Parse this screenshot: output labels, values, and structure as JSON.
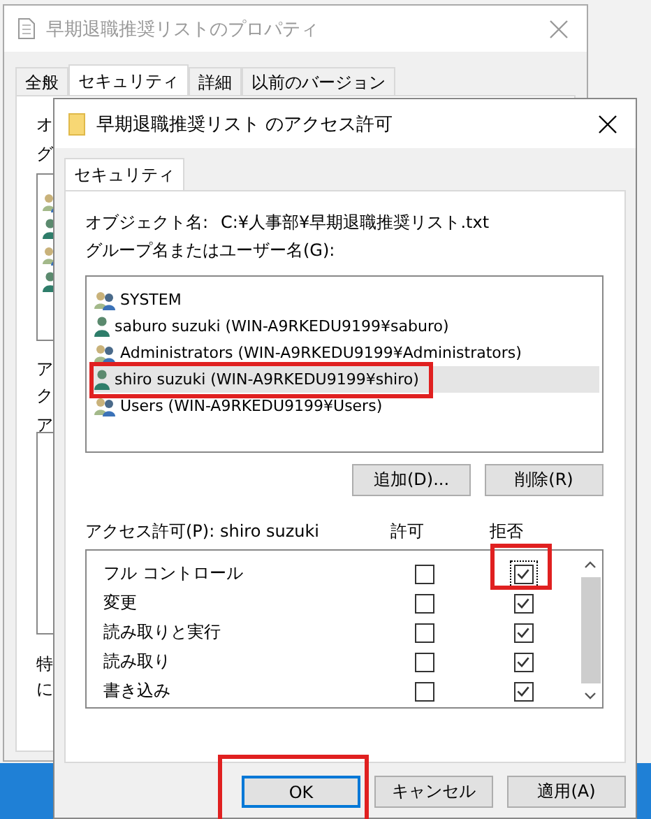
{
  "background_window": {
    "title": "早期退職推奨リストのプロパティ",
    "tabs": [
      {
        "label": "全般",
        "selected": false
      },
      {
        "label": "セキュリティ",
        "selected": true
      },
      {
        "label": "詳細",
        "selected": false
      },
      {
        "label": "以前のバージョン",
        "selected": false
      }
    ],
    "text_fragments": [
      "オ",
      "グ",
      "ア",
      "ク",
      "ア",
      "特",
      "に"
    ]
  },
  "dialog": {
    "title": "早期退職推奨リスト のアクセス許可",
    "tabs": [
      {
        "label": "セキュリティ",
        "selected": true
      }
    ],
    "object_label": "オブジェクト名:",
    "object_value": "C:¥人事部¥早期退職推奨リスト.txt",
    "group_label": "グループ名またはユーザー名(G):",
    "principals": [
      {
        "kind": "group",
        "name": "SYSTEM",
        "selected": false,
        "highlighted": false
      },
      {
        "kind": "user",
        "name": "saburo suzuki (WIN-A9RKEDU9199¥saburo)",
        "selected": false,
        "highlighted": false
      },
      {
        "kind": "group",
        "name": "Administrators (WIN-A9RKEDU9199¥Administrators)",
        "selected": false,
        "highlighted": false
      },
      {
        "kind": "user",
        "name": "shiro suzuki (WIN-A9RKEDU9199¥shiro)",
        "selected": true,
        "highlighted": true
      },
      {
        "kind": "group",
        "name": "Users (WIN-A9RKEDU9199¥Users)",
        "selected": false,
        "highlighted": false
      }
    ],
    "list_buttons": [
      "追加(D)...",
      "削除(R)"
    ],
    "permissions_label": "アクセス許可(P): shiro suzuki",
    "allow_header": "許可",
    "deny_header": "拒否",
    "permissions": [
      {
        "name": "フル コントロール",
        "allow": false,
        "deny": true,
        "focused": true,
        "deny_highlighted": true
      },
      {
        "name": "変更",
        "allow": false,
        "deny": true,
        "focused": false,
        "deny_highlighted": false
      },
      {
        "name": "読み取りと実行",
        "allow": false,
        "deny": true,
        "focused": false,
        "deny_highlighted": false
      },
      {
        "name": "読み取り",
        "allow": false,
        "deny": true,
        "focused": false,
        "deny_highlighted": false
      },
      {
        "name": "書き込み",
        "allow": false,
        "deny": true,
        "focused": false,
        "deny_highlighted": false
      }
    ],
    "buttons": [
      {
        "label": "OK",
        "default": true,
        "highlighted": true
      },
      {
        "label": "キャンセル",
        "default": false,
        "highlighted": false
      },
      {
        "label": "適用(A)",
        "default": false,
        "highlighted": false
      }
    ]
  }
}
